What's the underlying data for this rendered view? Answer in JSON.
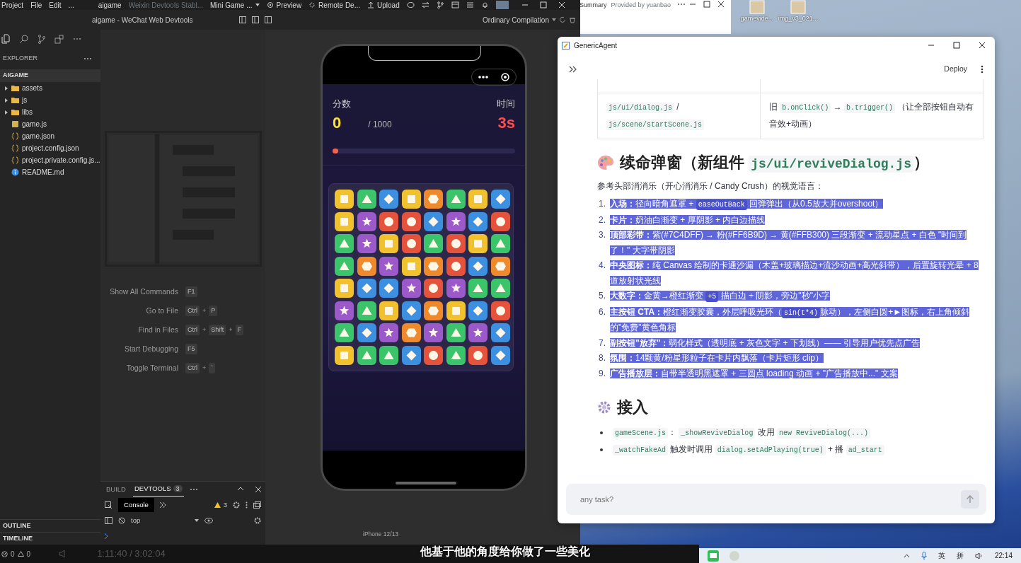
{
  "devtools": {
    "menubar": [
      "Project",
      "File",
      "Edit",
      "..."
    ],
    "project": "aigame",
    "version": "Weixin Devtools Stabl...",
    "mode": "Mini Game ...",
    "actions": [
      "Preview",
      "Remote De...",
      "Upload"
    ],
    "title": "aigame - WeChat Web Devtools",
    "compile_mode": "Ordinary Compilation",
    "explorer": {
      "title": "EXPLORER",
      "root": "AIGAME",
      "items": [
        {
          "name": "assets",
          "kind": "folder",
          "expanded": false
        },
        {
          "name": "js",
          "kind": "folder",
          "expanded": false
        },
        {
          "name": "libs",
          "kind": "folder",
          "expanded": false
        },
        {
          "name": "game.js",
          "kind": "js"
        },
        {
          "name": "game.json",
          "kind": "json"
        },
        {
          "name": "project.config.json",
          "kind": "json"
        },
        {
          "name": "project.private.config.js...",
          "kind": "json"
        },
        {
          "name": "README.md",
          "kind": "md"
        }
      ]
    },
    "commands": {
      "separator": "+",
      "items": [
        {
          "label": "Show All Commands",
          "keys": [
            "F1"
          ]
        },
        {
          "label": "Go to File",
          "keys": [
            "Ctrl",
            "P"
          ]
        },
        {
          "label": "Find in Files",
          "keys": [
            "Ctrl",
            "Shift",
            "F"
          ]
        },
        {
          "label": "Start Debugging",
          "keys": [
            "F5"
          ]
        },
        {
          "label": "Toggle Terminal",
          "keys": [
            "Ctrl",
            "`"
          ]
        }
      ]
    },
    "panel": {
      "tabs": [
        {
          "label": "BUILD",
          "selected": false
        },
        {
          "label": "DEVTOOLS",
          "selected": true,
          "badge": "3"
        }
      ],
      "console_tab": "Console",
      "warnings": "3",
      "context": "top"
    },
    "sections": [
      "OUTLINE",
      "TIMELINE"
    ],
    "status": {
      "errors": "0",
      "warnings": "0"
    },
    "device": "iPhone 12/13"
  },
  "game": {
    "score_label": "分数",
    "score": "0",
    "target": "/ 1000",
    "time_label": "时间",
    "time": "3s",
    "progress": {
      "level": 0.03
    },
    "board": [
      [
        {
          "kind": "square"
        },
        {
          "kind": "triangle"
        },
        {
          "kind": "diamond"
        },
        {
          "kind": "square"
        },
        {
          "kind": "hexagon"
        },
        {
          "kind": "triangle"
        },
        {
          "kind": "square"
        },
        {
          "kind": "diamond"
        }
      ],
      [
        {
          "kind": "square"
        },
        {
          "kind": "star"
        },
        {
          "kind": "circle"
        },
        {
          "kind": "circle"
        },
        {
          "kind": "diamond"
        },
        {
          "kind": "star"
        },
        {
          "kind": "diamond"
        },
        {
          "kind": "circle"
        }
      ],
      [
        {
          "kind": "triangle"
        },
        {
          "kind": "star"
        },
        {
          "kind": "square"
        },
        {
          "kind": "circle"
        },
        {
          "kind": "triangle"
        },
        {
          "kind": "circle"
        },
        {
          "kind": "square"
        },
        {
          "kind": "triangle"
        }
      ],
      [
        {
          "kind": "triangle"
        },
        {
          "kind": "hexagon"
        },
        {
          "kind": "star"
        },
        {
          "kind": "square"
        },
        {
          "kind": "hexagon"
        },
        {
          "kind": "circle"
        },
        {
          "kind": "diamond"
        },
        {
          "kind": "hexagon"
        }
      ],
      [
        {
          "kind": "square"
        },
        {
          "kind": "diamond"
        },
        {
          "kind": "diamond"
        },
        {
          "kind": "star"
        },
        {
          "kind": "circle"
        },
        {
          "kind": "star"
        },
        {
          "kind": "triangle"
        },
        {
          "kind": "triangle"
        }
      ],
      [
        {
          "kind": "star"
        },
        {
          "kind": "triangle"
        },
        {
          "kind": "square"
        },
        {
          "kind": "diamond"
        },
        {
          "kind": "hexagon"
        },
        {
          "kind": "square"
        },
        {
          "kind": "diamond"
        },
        {
          "kind": "circle"
        }
      ],
      [
        {
          "kind": "triangle"
        },
        {
          "kind": "diamond"
        },
        {
          "kind": "star"
        },
        {
          "kind": "hexagon"
        },
        {
          "kind": "star"
        },
        {
          "kind": "triangle"
        },
        {
          "kind": "star"
        },
        {
          "kind": "diamond"
        }
      ],
      [
        {
          "kind": "square"
        },
        {
          "kind": "triangle"
        },
        {
          "kind": "triangle"
        },
        {
          "kind": "diamond"
        },
        {
          "kind": "circle"
        },
        {
          "kind": "triangle"
        },
        {
          "kind": "circle"
        },
        {
          "kind": "diamond"
        }
      ]
    ]
  },
  "background_window": {
    "title": "Summary",
    "provider": "Provided by yuanbao"
  },
  "desktop_icons": [
    {
      "label": "gamevide..."
    },
    {
      "label": "img_v3_021..."
    }
  ],
  "agent": {
    "title": "GenericAgent",
    "deploy": "Deploy",
    "table_row": {
      "file": [
        {
          "kind": "code",
          "text": "js/ui/dialog.js"
        },
        {
          "kind": "text",
          "text": " / "
        },
        {
          "kind": "code",
          "text": "js/scene/startScene.js"
        }
      ],
      "change": [
        {
          "kind": "text",
          "text": "旧 "
        },
        {
          "kind": "code",
          "text": "b.onClick()"
        },
        {
          "kind": "text",
          "text": " → "
        },
        {
          "kind": "code",
          "text": "b.trigger()"
        },
        {
          "kind": "text",
          "text": " （让全部按钮自动有音效+动画）"
        }
      ]
    },
    "heading1": [
      {
        "kind": "text",
        "text": "续命弹窗（新组件 "
      },
      {
        "kind": "code",
        "text": "js/ui/reviveDialog.js"
      },
      {
        "kind": "text",
        "text": "）"
      }
    ],
    "intro": "参考头部消消乐（开心消消乐 / Candy Crush）的视觉语言：",
    "steps": [
      {
        "number": "1.",
        "selected": true,
        "parts": [
          {
            "kind": "text",
            "text": "**入场：**径向暗角遮罩 + "
          },
          {
            "kind": "code",
            "text": "easeOutBack"
          },
          {
            "kind": "text",
            "text": " 回弹弹出（从0.5放大并overshoot）"
          }
        ]
      },
      {
        "number": "2.",
        "selected": true,
        "parts": [
          {
            "kind": "text",
            "text": "**卡片：**奶油白渐变 + 厚阴影 + 内白边描线"
          }
        ]
      },
      {
        "number": "3.",
        "selected": true,
        "parts": [
          {
            "kind": "text",
            "text": "**顶部彩带：**紫(#7C4DFF) → 粉(#FF6B9D) → 黄(#FFB300) 三段渐变 + 流动星点 + 白色 \"时间到了！\" 大字带阴影"
          }
        ]
      },
      {
        "number": "4.",
        "selected": true,
        "parts": [
          {
            "kind": "text",
            "text": "**中央图标：**纯 Canvas 绘制的卡通沙漏（木盖+玻璃描边+流沙动画+高光斜带），后置旋转光晕 + 8 道放射状光线"
          }
        ]
      },
      {
        "number": "5.",
        "selected": true,
        "parts": [
          {
            "kind": "text",
            "text": "**大数字：**金黄→橙红渐变 "
          },
          {
            "kind": "code",
            "text": "+5"
          },
          {
            "kind": "text",
            "text": " 描白边 + 阴影，旁边\"秒\"小字"
          }
        ]
      },
      {
        "number": "6.",
        "selected": true,
        "parts": [
          {
            "kind": "text",
            "text": "**主按钮 CTA：**橙红渐变胶囊，外层呼吸光环（"
          },
          {
            "kind": "code",
            "text": "sin(t*4)"
          },
          {
            "kind": "text",
            "text": "脉动），左侧白圆+►图标，右上角倾斜的\"免费\"黄色角标"
          }
        ]
      },
      {
        "number": "7.",
        "selected": true,
        "parts": [
          {
            "kind": "text",
            "text": "**副按钮\"放弃\"：**弱化样式（透明底 + 灰色文字 + 下划线）—— 引导用户优先点广告"
          }
        ]
      },
      {
        "number": "8.",
        "selected": true,
        "parts": [
          {
            "kind": "text",
            "text": "**氛围：**14颗黄/粉星形粒子在卡片内飘落（卡片矩形 clip）"
          }
        ]
      },
      {
        "number": "9.",
        "selected": true,
        "parts": [
          {
            "kind": "text",
            "text": "**广告播放层：**自带半透明黑遮罩 + 三圆点 loading 动画 + \"广告播放中...\" 文案"
          }
        ]
      }
    ],
    "heading2": "接入",
    "bullets": [
      {
        "parts": [
          {
            "kind": "code",
            "text": "gameScene.js"
          },
          {
            "kind": "text",
            "text": "： "
          },
          {
            "kind": "code",
            "text": "_showReviveDialog"
          },
          {
            "kind": "text",
            "text": " 改用 "
          },
          {
            "kind": "code",
            "text": "new ReviveDialog(...)"
          }
        ]
      },
      {
        "parts": [
          {
            "kind": "code",
            "text": "_watchFakeAd"
          },
          {
            "kind": "text",
            "text": " 触发时调用 "
          },
          {
            "kind": "code",
            "text": "dialog.setAdPlaying(true)"
          },
          {
            "kind": "text",
            "text": " + 播 "
          },
          {
            "kind": "code",
            "text": "ad_start"
          }
        ]
      }
    ],
    "input": {
      "placeholder": "any task?"
    }
  },
  "video": {
    "time": "1:11:40 / 3:02:04",
    "subtitle": "他基于他的角度给你做了一些美化"
  },
  "taskbar": {
    "ime": [
      "英",
      "拼"
    ],
    "clock": "22:14"
  }
}
